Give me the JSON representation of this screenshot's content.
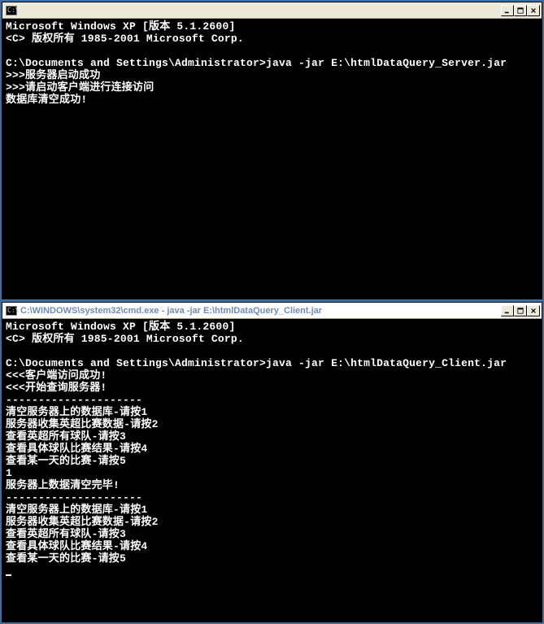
{
  "window1": {
    "icon_text": "C:\\",
    "title": "",
    "lines": [
      "Microsoft Windows XP [版本 5.1.2600]",
      "<C> 版权所有 1985-2001 Microsoft Corp.",
      "",
      "C:\\Documents and Settings\\Administrator>java -jar E:\\htmlDataQuery_Server.jar",
      ">>>服务器启动成功",
      ">>>请启动客户端进行连接访问",
      "数据库清空成功!"
    ]
  },
  "window2": {
    "icon_text": "C:\\",
    "title": "C:\\WINDOWS\\system32\\cmd.exe - java -jar E:\\htmlDataQuery_Client.jar",
    "lines": [
      "Microsoft Windows XP [版本 5.1.2600]",
      "<C> 版权所有 1985-2001 Microsoft Corp.",
      "",
      "C:\\Documents and Settings\\Administrator>java -jar E:\\htmlDataQuery_Client.jar",
      "<<<客户端访问成功!",
      "<<<开始查询服务器!",
      "---------------------",
      "清空服务器上的数据库-请按1",
      "服务器收集英超比赛数据-请按2",
      "查看英超所有球队-请按3",
      "查看具体球队比赛结果-请按4",
      "查看某一天的比赛-请按5",
      "1",
      "服务器上数据清空完毕!",
      "---------------------",
      "清空服务器上的数据库-请按1",
      "服务器收集英超比赛数据-请按2",
      "查看英超所有球队-请按3",
      "查看具体球队比赛结果-请按4",
      "查看某一天的比赛-请按5"
    ]
  }
}
